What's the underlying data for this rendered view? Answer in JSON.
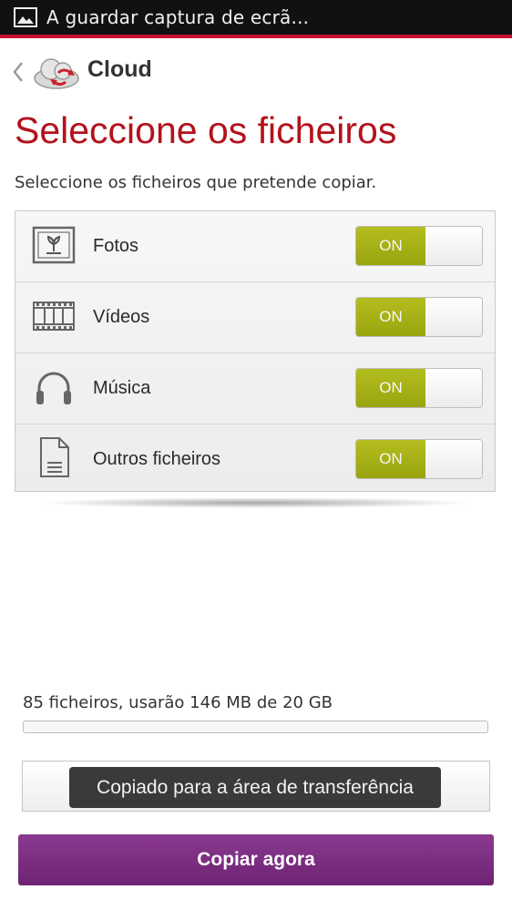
{
  "status_bar": {
    "notification_text": "A guardar captura de ecrã..."
  },
  "action_bar": {
    "title": "Cloud"
  },
  "page": {
    "title": "Seleccione os ficheiros",
    "subtitle": "Seleccione os ficheiros que pretende copiar."
  },
  "options": [
    {
      "label": "Fotos",
      "icon": "photo-icon",
      "toggle": "ON"
    },
    {
      "label": "Vídeos",
      "icon": "film-icon",
      "toggle": "ON"
    },
    {
      "label": "Música",
      "icon": "headphones-icon",
      "toggle": "ON"
    },
    {
      "label": "Outros ficheiros",
      "icon": "document-icon",
      "toggle": "ON"
    }
  ],
  "usage": {
    "text": "85 ficheiros, usarão 146 MB de 20 GB",
    "progress_fraction": 0.0
  },
  "toast": {
    "text": "Copiado para a área de transferência"
  },
  "button": {
    "label": "Copiar agora"
  },
  "colors": {
    "accent_red": "#b3121d",
    "toggle_green": "#a2ab14",
    "button_purple": "#7a2c7f"
  }
}
